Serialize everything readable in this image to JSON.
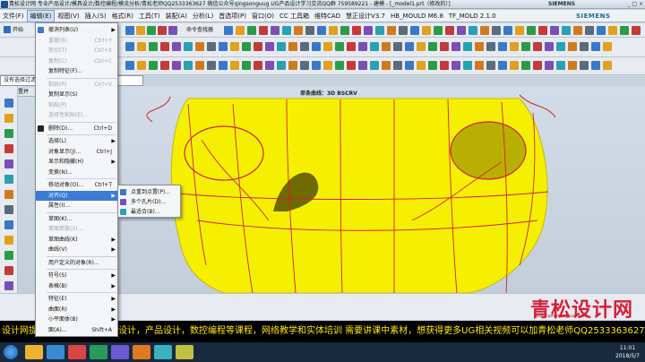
{
  "window": {
    "title": "青松设计网 专业产品设计/模具设计/数控编程/模流分析/青松老师QQ2533363627 微信公众号qingsonguug UG产品设计学习交流QQ群 759589221 - 建模 - [_model1.prt（修改的）]",
    "brand": "SIEMENS",
    "controls": "_ □ ×"
  },
  "menubar": {
    "items": [
      "文件(F)",
      "编辑(E)",
      "视图(V)",
      "插入(S)",
      "格式(R)",
      "工具(T)",
      "装配(A)",
      "分析(L)",
      "首选项(P)",
      "窗口(O)",
      "CC 工具箱",
      "维特CAD",
      "慧正设计V3.7",
      "HB_MOULD M6.8",
      "TF_MOLD 2.1.0"
    ],
    "active": "编辑(E)"
  },
  "toolbar": {
    "start_label": "开始",
    "command_finder": "命令查找器"
  },
  "selection": {
    "filter": "没有选择过滤器",
    "nav_header": "选择设置并"
  },
  "viewport": {
    "label": "单条曲线：3D BSCRV",
    "model_color": "#f5f000",
    "curve_color": "#d4213a"
  },
  "edit_menu": [
    {
      "label": "撤消列表(U)",
      "icon": "undo-icon",
      "sub": true
    },
    {
      "label": "重做(R)",
      "shortcut": "Ctrl+Y",
      "disabled": true
    },
    {
      "label": "剪切(T)",
      "shortcut": "Ctrl+X",
      "disabled": true
    },
    {
      "label": "复制(C)",
      "shortcut": "Ctrl+C",
      "disabled": true
    },
    {
      "label": "复制特征(F)..."
    },
    {
      "label": "粘贴(P)",
      "shortcut": "Ctrl+V",
      "disabled": true
    },
    {
      "label": "复制显示(S)"
    },
    {
      "label": "粘贴(P)",
      "disabled": true
    },
    {
      "label": "选择性粘贴(E)...",
      "disabled": true
    },
    {
      "label": "删除(D)...",
      "shortcut": "Ctrl+D",
      "icon": "delete-icon"
    },
    {
      "label": "选择(L)",
      "sub": true
    },
    {
      "label": "对象显示(J)...",
      "shortcut": "Ctrl+J"
    },
    {
      "label": "显示和隐藏(H)",
      "sub": true
    },
    {
      "label": "变换(N)..."
    },
    {
      "label": "移动对象(O)...",
      "shortcut": "Ctrl+T"
    },
    {
      "label": "对齐(Q)",
      "sub": true,
      "highlight": true
    },
    {
      "label": "属性(I)..."
    },
    {
      "label": "草图(K)..."
    },
    {
      "label": "草图参数(S)...",
      "disabled": true
    },
    {
      "label": "草图曲线(K)",
      "sub": true
    },
    {
      "label": "曲线(V)",
      "sub": true
    },
    {
      "label": "用户定义的对象(R)..."
    },
    {
      "label": "符号(S)",
      "sub": true
    },
    {
      "label": "表格(B)",
      "sub": true
    },
    {
      "label": "特征(E)",
      "sub": true
    },
    {
      "label": "曲面(R)",
      "sub": true
    },
    {
      "label": "小平面体(B)",
      "sub": true
    },
    {
      "label": "面(A)...",
      "shortcut": "Shift+A"
    }
  ],
  "align_submenu": [
    {
      "label": "点重到点置(P)..."
    },
    {
      "label": "多个孔片(D)..."
    },
    {
      "label": "最适合(B)..."
    }
  ],
  "banner": "设计网提供一整套，工业模具设计，产品设计，数控编程等课程，网络教学和实体培训 需要讲课中素材，想获得更多UG相关视频可以加青松老师QQ2533363627",
  "watermark": {
    "cn": "青松设计网",
    "site": "www.qingsonguug.com"
  },
  "clock": {
    "time": "11:01",
    "date": "2018/5/7"
  }
}
